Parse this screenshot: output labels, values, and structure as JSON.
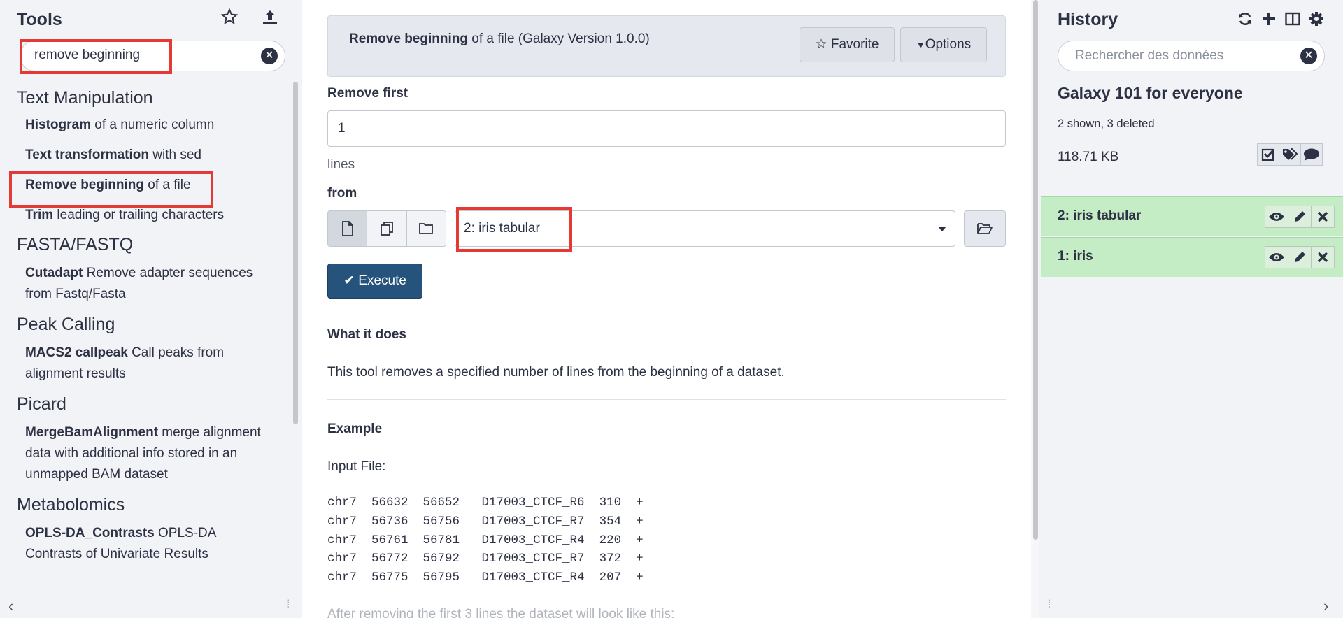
{
  "tool_panel": {
    "title": "Tools",
    "search_value": "remove beginning",
    "sections": [
      {
        "title": "Text Manipulation",
        "tools": [
          {
            "name": "Histogram",
            "desc": " of a numeric column"
          },
          {
            "name": "Text transformation",
            "desc": " with sed"
          },
          {
            "name": "Remove beginning",
            "desc": " of a file"
          },
          {
            "name": "Trim",
            "desc": " leading or trailing characters"
          }
        ]
      },
      {
        "title": "FASTA/FASTQ",
        "tools": [
          {
            "name": "Cutadapt",
            "desc": " Remove adapter sequences from Fastq/Fasta"
          }
        ]
      },
      {
        "title": "Peak Calling",
        "tools": [
          {
            "name": "MACS2 callpeak",
            "desc": " Call peaks from alignment results"
          }
        ]
      },
      {
        "title": "Picard",
        "tools": [
          {
            "name": "MergeBamAlignment",
            "desc": " merge alignment data with additional info stored in an unmapped BAM dataset"
          }
        ]
      },
      {
        "title": "Metabolomics",
        "tools": [
          {
            "name": "OPLS-DA_Contrasts",
            "desc": " OPLS-DA Contrasts of Univariate Results"
          }
        ]
      }
    ]
  },
  "tool_form": {
    "title_bold": "Remove beginning",
    "title_rest": " of a file (Galaxy Version 1.0.0)",
    "favorite_label": "Favorite",
    "options_label": "Options",
    "remove_first_label": "Remove first",
    "remove_first_value": "1",
    "remove_first_help": "lines",
    "from_label": "from",
    "from_value": "2: iris tabular",
    "execute_label": "Execute",
    "what_it_does_heading": "What it does",
    "what_it_does_text": "This tool removes a specified number of lines from the beginning of a dataset.",
    "example_heading": "Example",
    "input_file_label": "Input File:",
    "example_rows": [
      "chr7  56632  56652   D17003_CTCF_R6  310  +",
      "chr7  56736  56756   D17003_CTCF_R7  354  +",
      "chr7  56761  56781   D17003_CTCF_R4  220  +",
      "chr7  56772  56792   D17003_CTCF_R7  372  +",
      "chr7  56775  56795   D17003_CTCF_R4  207  +"
    ],
    "after_text": "After removing the first 3 lines the dataset will look like this:"
  },
  "history": {
    "title": "History",
    "search_placeholder": "Rechercher des données",
    "name": "Galaxy 101 for everyone",
    "meta": "2 shown, 3 deleted",
    "size": "118.71 KB",
    "datasets": [
      {
        "label": "2: iris tabular"
      },
      {
        "label": "1: iris"
      }
    ]
  },
  "colors": {
    "accent": "#25537b",
    "dataset_ok": "#c4ecc5",
    "highlight": "#e53935"
  }
}
